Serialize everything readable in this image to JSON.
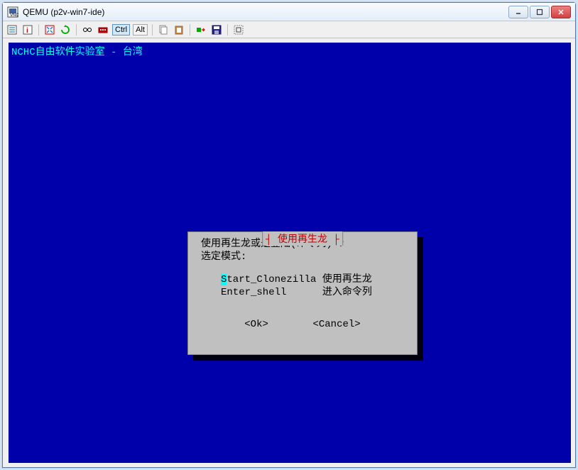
{
  "window": {
    "title": "QEMU (p2v-win7-ide)"
  },
  "toolbar": {
    "ctrl_label": "Ctrl",
    "alt_label": "Alt"
  },
  "terminal": {
    "header": "NCHC自由软件实验室 - 台湾"
  },
  "dialog": {
    "title": "使用再生龙",
    "line1": "使用再生龙或是登陆(命令列) ?",
    "line2": "选定模式:",
    "menu": {
      "item1_key": "S",
      "item1_rest": "tart_Clonezilla 使用再生龙",
      "item2": "Enter_shell      进入命令列"
    },
    "ok": "<Ok>",
    "cancel": "<Cancel>"
  }
}
